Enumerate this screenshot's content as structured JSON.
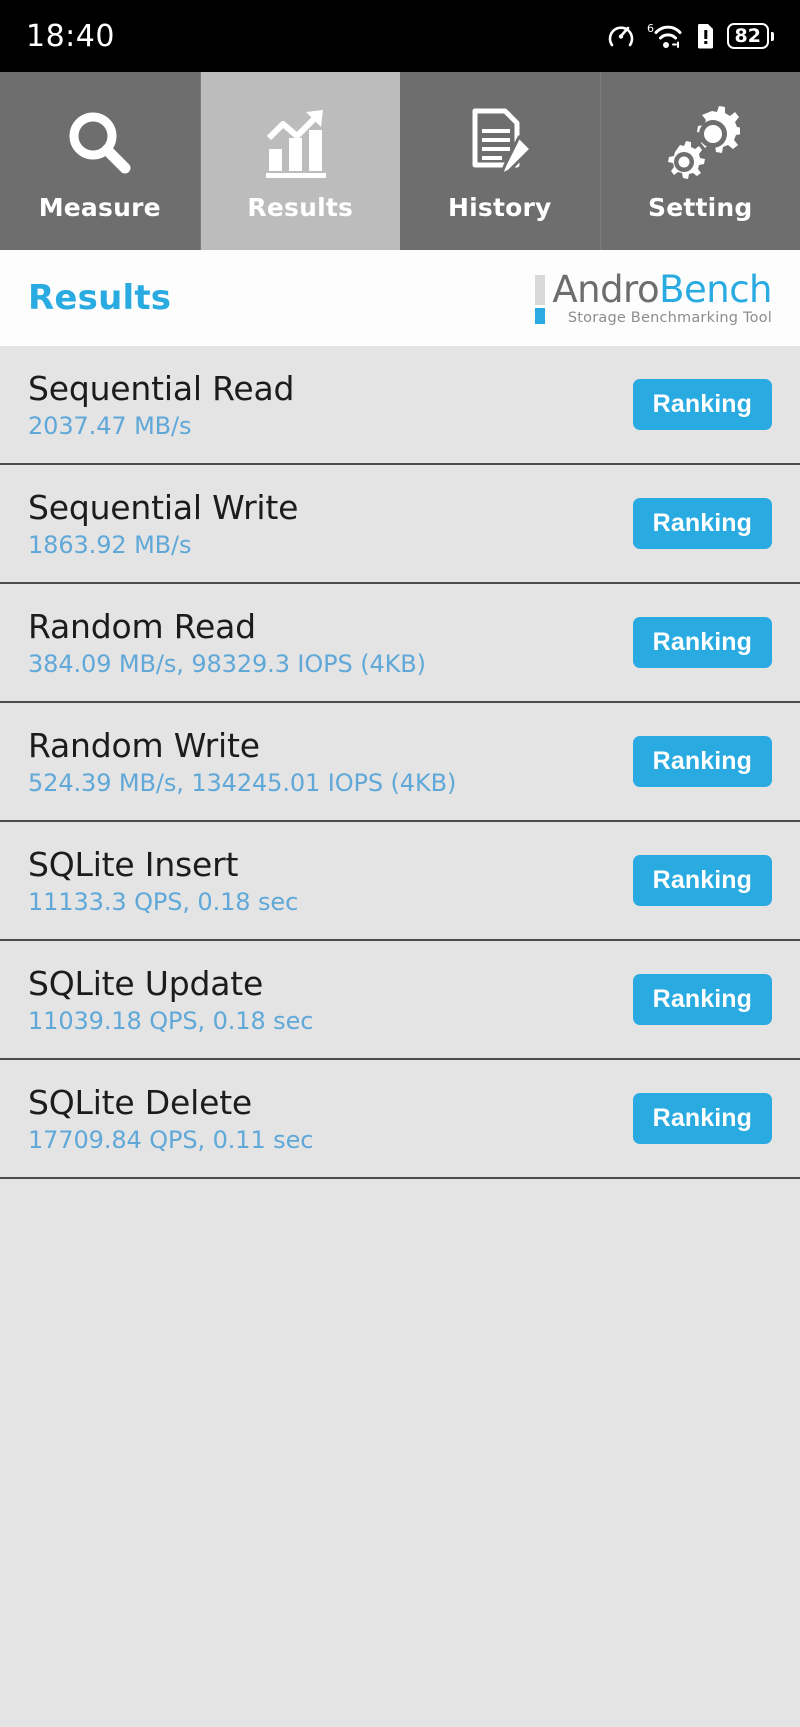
{
  "status_bar": {
    "time": "18:40",
    "icons": [
      "data-saver-icon",
      "wifi-6-icon",
      "sim-alert-icon"
    ],
    "battery_level": "82"
  },
  "tabs": [
    {
      "label": "Measure",
      "icon": "search-icon",
      "active": false
    },
    {
      "label": "Results",
      "icon": "bar-chart-icon",
      "active": true
    },
    {
      "label": "History",
      "icon": "document-edit-icon",
      "active": false
    },
    {
      "label": "Setting",
      "icon": "gears-icon",
      "active": false
    }
  ],
  "header": {
    "title": "Results",
    "brand_name_first": "Andro",
    "brand_name_second": "Bench",
    "brand_tagline": "Storage Benchmarking Tool"
  },
  "colors": {
    "accent": "#29abe2",
    "value_text": "#5fa8d8",
    "list_bg": "#e4e4e4",
    "tab_bg": "#6e6e6e",
    "tab_active_bg": "#bcbcbc"
  },
  "results": [
    {
      "name": "Sequential Read",
      "value": "2037.47 MB/s",
      "action": "Ranking"
    },
    {
      "name": "Sequential Write",
      "value": "1863.92 MB/s",
      "action": "Ranking"
    },
    {
      "name": "Random Read",
      "value": "384.09 MB/s, 98329.3 IOPS (4KB)",
      "action": "Ranking"
    },
    {
      "name": "Random Write",
      "value": "524.39 MB/s, 134245.01 IOPS (4KB)",
      "action": "Ranking"
    },
    {
      "name": "SQLite Insert",
      "value": "11133.3 QPS, 0.18 sec",
      "action": "Ranking"
    },
    {
      "name": "SQLite Update",
      "value": "11039.18 QPS, 0.18 sec",
      "action": "Ranking"
    },
    {
      "name": "SQLite Delete",
      "value": "17709.84 QPS, 0.11 sec",
      "action": "Ranking"
    }
  ]
}
